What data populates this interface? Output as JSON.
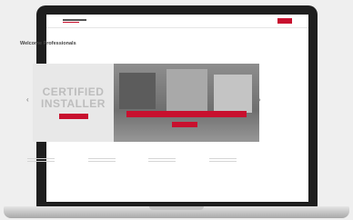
{
  "header": {
    "nav": [
      "",
      "",
      "",
      ""
    ],
    "right_links": [
      "",
      ""
    ]
  },
  "page": {
    "title": "Welcome Professionals"
  },
  "carousel": {
    "slide_heading_1": "CERTIFIED",
    "slide_heading_2": "INSTALLER",
    "slide_subline": "",
    "slide_badge": "",
    "photo_banner": "",
    "photo_button": ""
  },
  "features": [
    {
      "title": ""
    },
    {
      "title": ""
    },
    {
      "title": ""
    },
    {
      "title": ""
    }
  ],
  "colors": {
    "brand": "#c8102e",
    "laptop": "#1e1e1e"
  }
}
